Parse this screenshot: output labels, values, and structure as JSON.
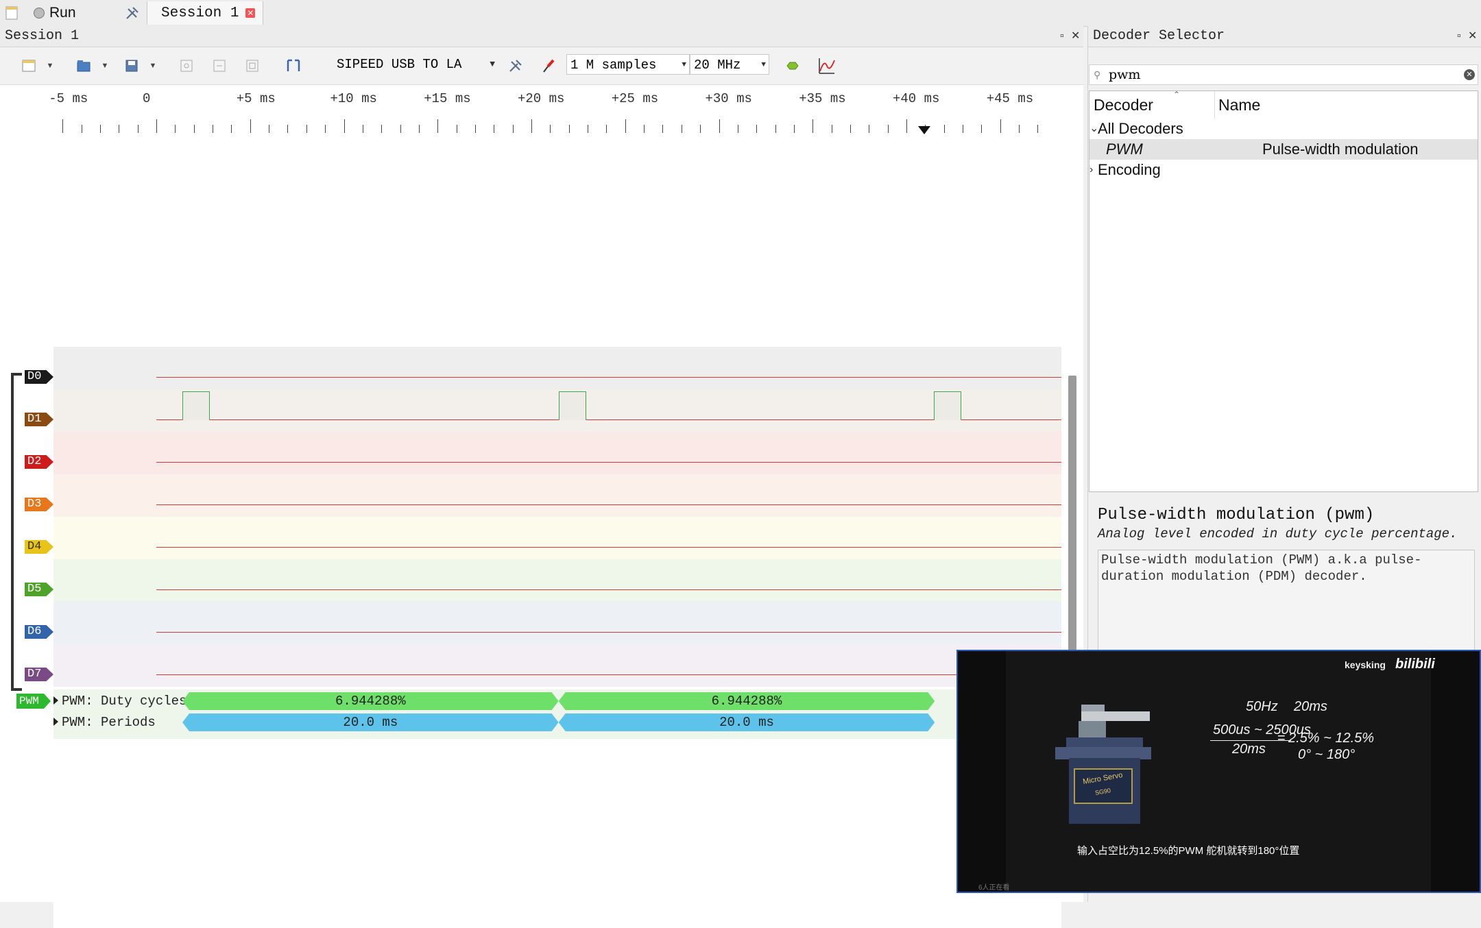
{
  "topbar": {
    "run_label": "Run",
    "session_tab_label": "Session 1"
  },
  "session": {
    "title": "Session 1",
    "device": "SIPEED USB TO LA",
    "samples": "1 M samples",
    "rate": "20 MHz",
    "ruler_labels": [
      "-5 ms",
      "0",
      "+5 ms",
      "+10 ms",
      "+15 ms",
      "+20 ms",
      "+25 ms",
      "+30 ms",
      "+35 ms",
      "+40 ms",
      "+45 ms"
    ],
    "channels": [
      {
        "label": "D0",
        "color": "#1a1a1a",
        "bg": "#eeeeee"
      },
      {
        "label": "D1",
        "color": "#8a4a12",
        "bg": "#f3efea"
      },
      {
        "label": "D2",
        "color": "#cc1c1c",
        "bg": "#fbe9e8"
      },
      {
        "label": "D3",
        "color": "#e8761a",
        "bg": "#fcf1ea"
      },
      {
        "label": "D4",
        "color": "#e8c31a",
        "bg": "#fdfbec"
      },
      {
        "label": "D5",
        "color": "#4fa32a",
        "bg": "#eff6ea"
      },
      {
        "label": "D6",
        "color": "#3164a8",
        "bg": "#edf0f5"
      },
      {
        "label": "D7",
        "color": "#7a4a86",
        "bg": "#f3eff4"
      }
    ],
    "decoder": {
      "label": "PWM",
      "rows": [
        {
          "name": "PWM: Duty cycles",
          "values": [
            "6.944288%",
            "6.944288%"
          ],
          "color": "#6ee06a"
        },
        {
          "name": "PWM: Periods",
          "values": [
            "20.0 ms",
            "20.0 ms"
          ],
          "color": "#5ec3ea"
        }
      ]
    }
  },
  "decoder_selector": {
    "title": "Decoder Selector",
    "search_value": "pwm",
    "columns": [
      "Decoder",
      "Name"
    ],
    "group_all": "All Decoders",
    "selected_row": {
      "decoder": "PWM",
      "name": "Pulse-width modulation"
    },
    "group_encoding": "Encoding",
    "detail_title": "Pulse-width modulation (pwm)",
    "detail_subtitle": "Analog level encoded in duty cycle percentage.",
    "detail_desc": "Pulse-width modulation (PWM) a.k.a pulse-duration modulation (PDM) decoder."
  },
  "video": {
    "brand": "keysking",
    "brand2": "bilibili",
    "servo_label": "Micro Servo",
    "servo_model": "SG90",
    "freq": "50Hz",
    "period": "20ms",
    "pulse_range": "500us ~ 2500us",
    "denominator": "20ms",
    "equals": "=",
    "duty_range": "2.5% ~ 12.5%",
    "angle_range": "0° ~ 180°",
    "subtitle": "输入占空比为12.5%的PWM 舵机就转到180°位置",
    "viewers": "6人正在看"
  }
}
